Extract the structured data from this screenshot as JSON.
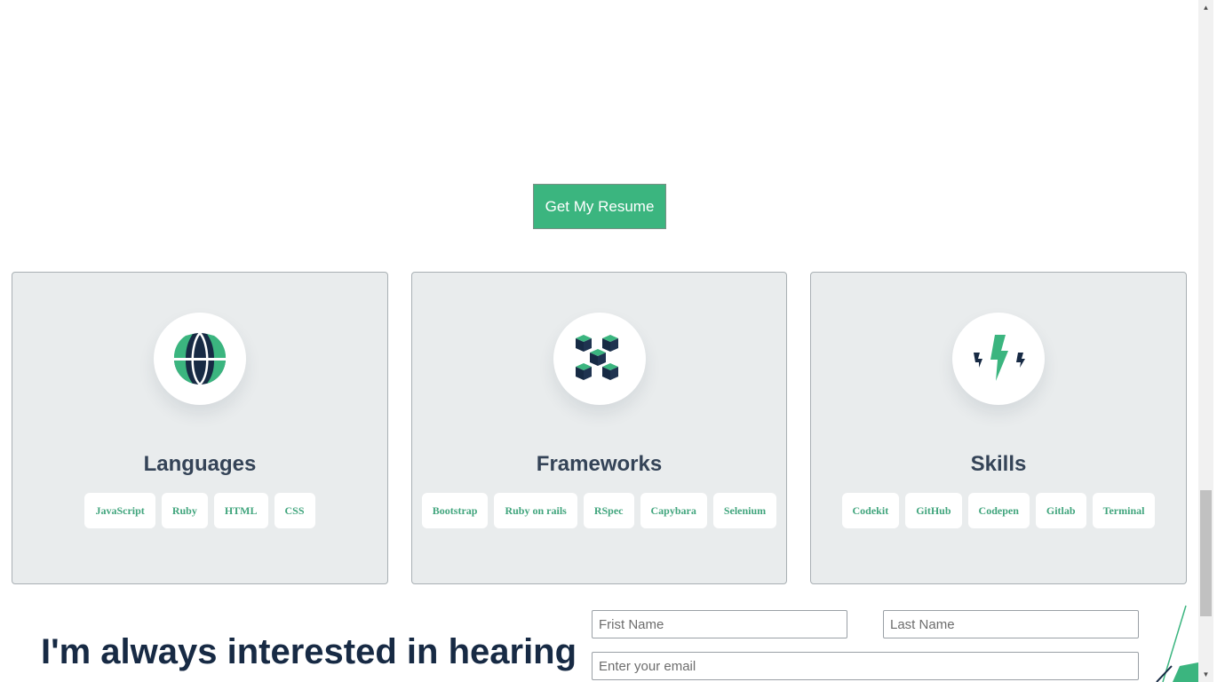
{
  "resume_button": {
    "label": "Get My Resume"
  },
  "cards": [
    {
      "title": "Languages",
      "icon": "globe-icon",
      "tags": [
        "JavaScript",
        "Ruby",
        "HTML",
        "CSS"
      ]
    },
    {
      "title": "Frameworks",
      "icon": "cubes-icon",
      "tags": [
        "Bootstrap",
        "Ruby on rails",
        "RSpec",
        "Capybara",
        "Selenium"
      ]
    },
    {
      "title": "Skills",
      "icon": "lightning-icon",
      "tags": [
        "Codekit",
        "GitHub",
        "Codepen",
        "Gitlab",
        "Terminal"
      ]
    }
  ],
  "contact": {
    "heading": "I'm always interested in hearing",
    "first_name_placeholder": "Frist Name",
    "last_name_placeholder": "Last Name",
    "email_placeholder": "Enter your email"
  },
  "colors": {
    "accent": "#3bb57f",
    "navy": "#172a44",
    "card_bg": "#e9eced",
    "tag_text": "#41a57d"
  },
  "scrollbar": {
    "icons": [
      "arrow-up-icon",
      "arrow-down-icon"
    ]
  }
}
